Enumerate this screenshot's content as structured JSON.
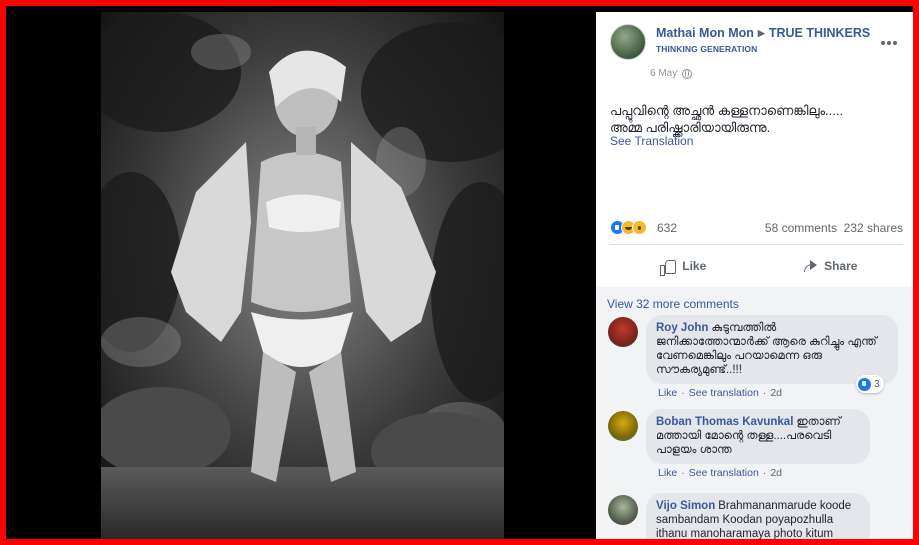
{
  "post": {
    "author": "Mathai Mon Mon",
    "group": "TRUE THINKERS",
    "subgroup": "THINKING GENERATION",
    "date": "6 May",
    "text_line1": "പപ്പുവിന്റെ അച്ഛൻ കള്ളനാണെങ്കിലും.....",
    "text_line2": "അമ്മ പരിഷ്ക്കാരിയായിരുന്നു.",
    "see_translation": "See Translation"
  },
  "stats": {
    "reactions": "632",
    "comments": "58 comments",
    "shares": "232 shares"
  },
  "actions": {
    "like": "Like",
    "share": "Share"
  },
  "comments": {
    "view_more": "View 32 more comments",
    "items": [
      {
        "author": "Roy John",
        "text": "കുടുമ്പത്തിൽ ജനിക്കാത്തോന്മാർക്ക് ആരെ കുറിച്ചും എന്ത് വേണമെങ്കിലും പറയാമെന്ന ഒരു സൗകര്യമുണ്ട്..!!!",
        "like": "Like",
        "see_translation": "See translation",
        "time": "2d",
        "reaction_count": "3"
      },
      {
        "author": "Boban Thomas Kavunkal",
        "text": "ഇതാണ് മത്തായി മോന്റെ തള്ള....പരവെടി പാളയം ശാന്ത",
        "like": "Like",
        "see_translation": "See translation",
        "time": "2d"
      },
      {
        "author": "Vijo Simon",
        "text": "Brahmananmarude koode sambandam Koodan poyapozhulla ithanu manoharamaya photo kitum"
      }
    ]
  },
  "colors": {
    "border": "#ff0000",
    "link": "#385898",
    "bubble": "#e4e6eb"
  }
}
